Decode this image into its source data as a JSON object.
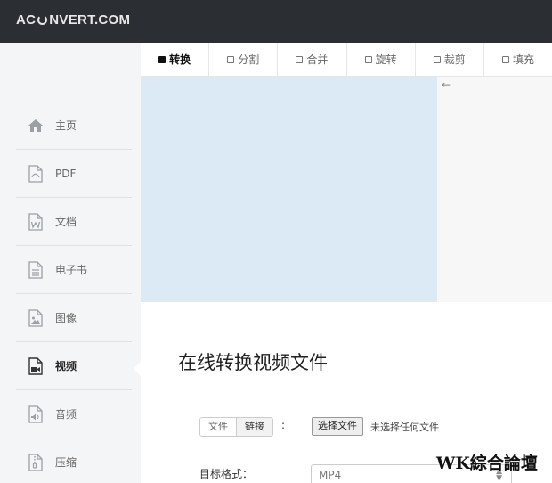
{
  "brand": {
    "logo_left": "AC",
    "logo_right": "NVERT.COM"
  },
  "sidebar": {
    "items": [
      {
        "label": "主页",
        "icon": "home-icon"
      },
      {
        "label": "PDF",
        "icon": "pdf-file-icon"
      },
      {
        "label": "文档",
        "icon": "word-document-icon"
      },
      {
        "label": "电子书",
        "icon": "ebook-icon"
      },
      {
        "label": "图像",
        "icon": "image-icon"
      },
      {
        "label": "视频",
        "icon": "video-icon",
        "active": true
      },
      {
        "label": "音频",
        "icon": "audio-icon"
      },
      {
        "label": "压缩",
        "icon": "archive-icon"
      }
    ]
  },
  "tabs": [
    {
      "label": "转换",
      "active": true
    },
    {
      "label": "分割"
    },
    {
      "label": "合并"
    },
    {
      "label": "旋转"
    },
    {
      "label": "裁剪"
    },
    {
      "label": "填充"
    }
  ],
  "main": {
    "title": "在线转换视频文件",
    "source_toggle": {
      "file_label": "文件",
      "link_label": "链接"
    },
    "colon": ":",
    "file_button": "选择文件",
    "file_status": "未选择任何文件",
    "format_label": "目标格式：",
    "format_value": "MP4"
  },
  "watermark": "WK綜合論壇",
  "colors": {
    "topbar": "#2b2f33",
    "sidebar_bg": "#f4f5f6",
    "ad_area": "#dbeaf5"
  }
}
